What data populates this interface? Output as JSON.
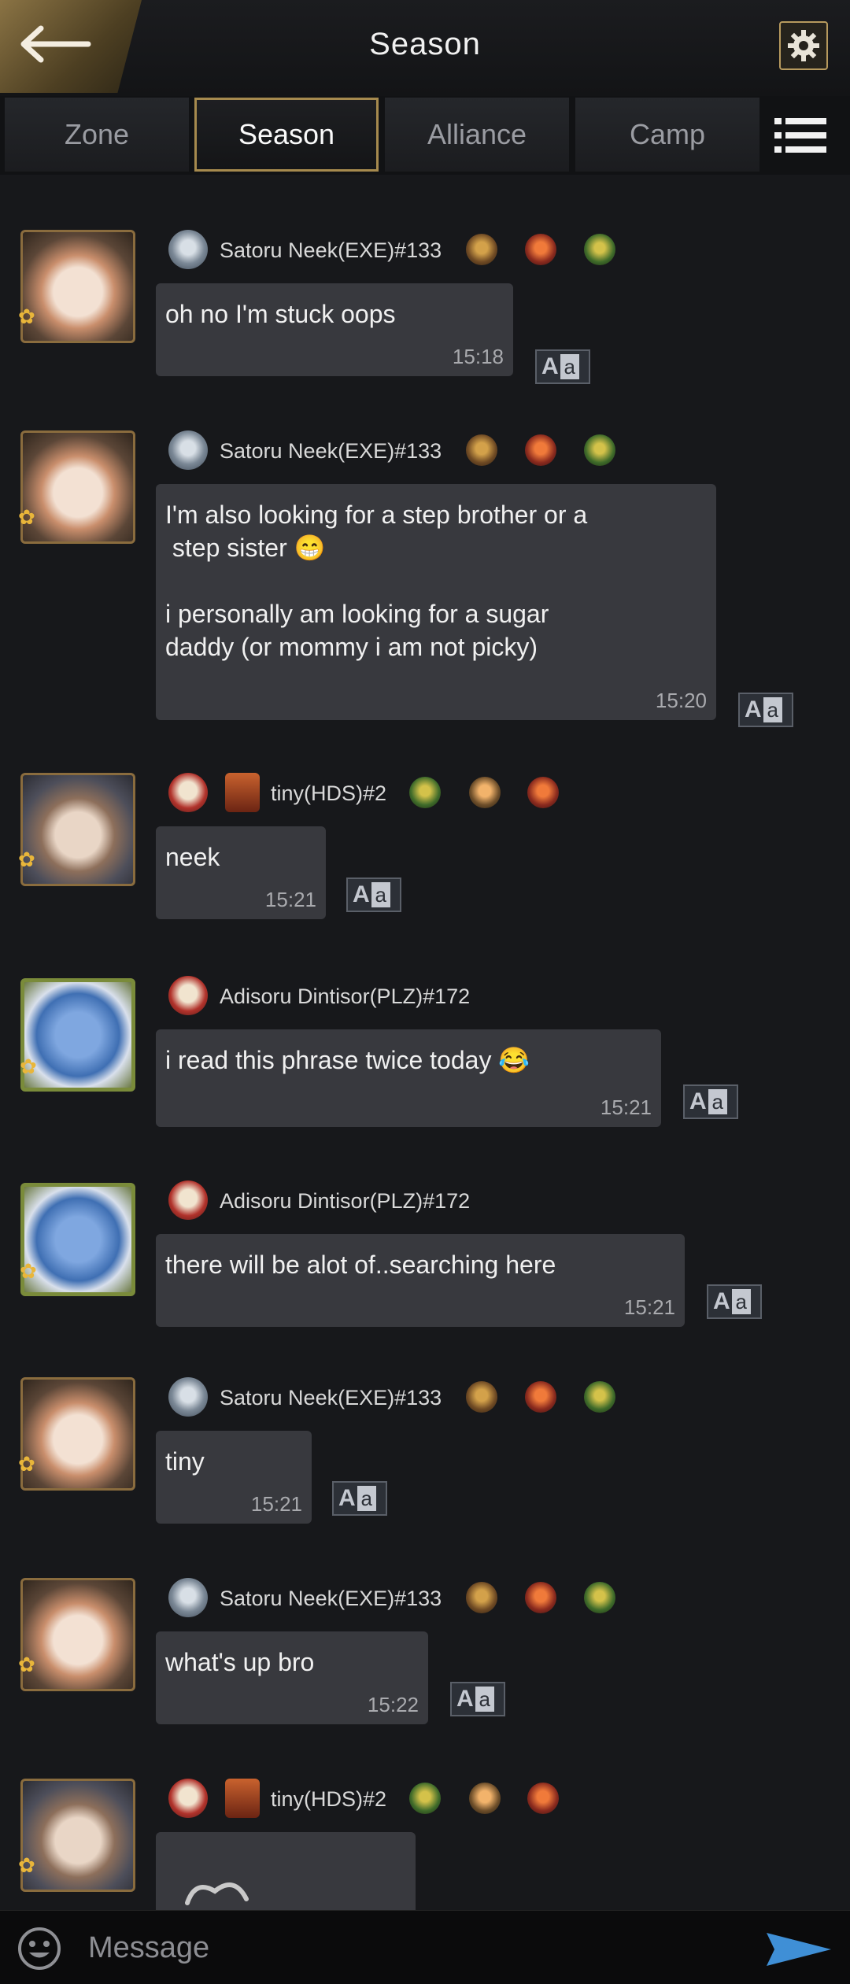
{
  "header": {
    "title": "Season",
    "back_icon": "back-arrow-icon",
    "settings_icon": "gear-icon"
  },
  "tabs": [
    {
      "label": "Zone",
      "active": false
    },
    {
      "label": "Season",
      "active": true
    },
    {
      "label": "Alliance",
      "active": false
    },
    {
      "label": "Camp",
      "active": false
    }
  ],
  "menu_icon": "list-menu-icon",
  "messages": [
    {
      "user": "Satoru Neek(EXE)#133",
      "avatar": "satoru",
      "text": "oh no I'm stuck oops",
      "time": "15:18"
    },
    {
      "user": "Satoru Neek(EXE)#133",
      "avatar": "satoru",
      "text": "I'm also looking for a step brother or a\n step sister 😁\n\ni personally am looking for a sugar\ndaddy (or mommy i am not picky)",
      "time": "15:20"
    },
    {
      "user": "tiny(HDS)#2",
      "avatar": "tiny",
      "text": "neek",
      "time": "15:21"
    },
    {
      "user": "Adisoru Dintisor(PLZ)#172",
      "avatar": "adisoru",
      "text": "i read this phrase twice today 😂",
      "time": "15:21"
    },
    {
      "user": "Adisoru Dintisor(PLZ)#172",
      "avatar": "adisoru",
      "text": "there will be alot of..searching here",
      "time": "15:21"
    },
    {
      "user": "Satoru Neek(EXE)#133",
      "avatar": "satoru",
      "text": "tiny",
      "time": "15:21"
    },
    {
      "user": "Satoru Neek(EXE)#133",
      "avatar": "satoru",
      "text": "what's up bro",
      "time": "15:22"
    },
    {
      "user": "tiny(HDS)#2",
      "avatar": "tiny",
      "text": "",
      "time": ""
    }
  ],
  "translate_label": {
    "upper": "A",
    "lower": "a"
  },
  "footer": {
    "placeholder": "Message",
    "emoji_icon": "smiley-icon",
    "send_icon": "send-icon"
  }
}
